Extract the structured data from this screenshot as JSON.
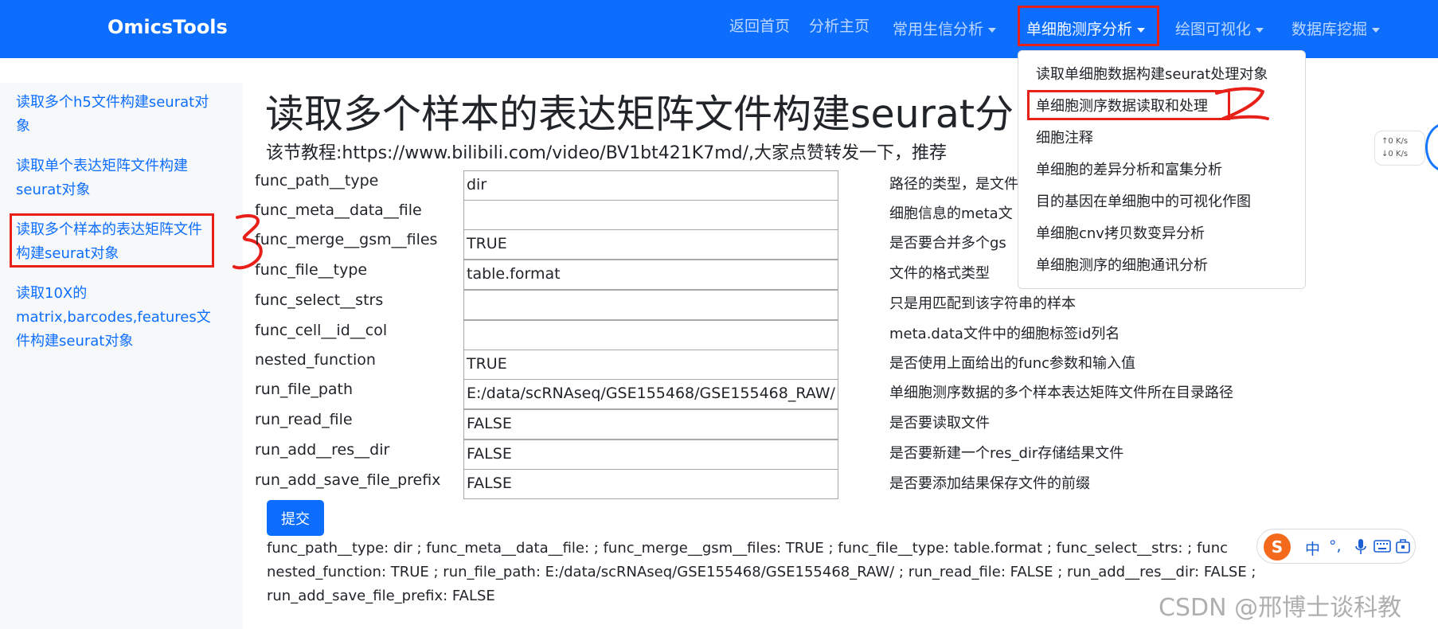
{
  "navbar": {
    "brand": "OmicsTools",
    "items": [
      {
        "label": "返回首页",
        "dropdown": false
      },
      {
        "label": "分析主页",
        "dropdown": false
      },
      {
        "label": "常用生信分析",
        "dropdown": true
      },
      {
        "label": "单细胞测序分析",
        "dropdown": true,
        "active": true
      },
      {
        "label": "绘图可视化",
        "dropdown": true
      },
      {
        "label": "数据库挖掘",
        "dropdown": true
      }
    ]
  },
  "dropdown": {
    "items": [
      "读取单细胞数据构建seurat处理对象",
      "单细胞测序数据读取和处理",
      "细胞注释",
      "单细胞的差异分析和富集分析",
      "目的基因在单细胞中的可视化作图",
      "单细胞cnv拷贝数变异分析",
      "单细胞测序的细胞通讯分析"
    ]
  },
  "sidebar": {
    "links": [
      "读取多个h5文件构建seurat对象",
      "读取单个表达矩阵文件构建seurat对象",
      "读取多个样本的表达矩阵文件构建seurat对象",
      "读取10X的matrix,barcodes,features文件构建seurat对象"
    ]
  },
  "main": {
    "title": "读取多个样本的表达矩阵文件构建seurat分",
    "subtitle": "该节教程:https://www.bilibili.com/video/BV1bt421K7md/,大家点赞转发一下，推荐",
    "params": [
      {
        "name": "func_path__type",
        "value": "dir",
        "desc": "路径的类型，是文件"
      },
      {
        "name": "func_meta__data__file",
        "value": "",
        "desc": "细胞信息的meta文"
      },
      {
        "name": "func_merge__gsm__files",
        "value": "TRUE",
        "desc": "是否要合并多个gs"
      },
      {
        "name": "func_file__type",
        "value": "table.format",
        "desc": "文件的格式类型"
      },
      {
        "name": "func_select__strs",
        "value": "",
        "desc": "只是用匹配到该字符串的样本"
      },
      {
        "name": "func_cell__id__col",
        "value": "",
        "desc": "meta.data文件中的细胞标签id列名"
      },
      {
        "name": "nested_function",
        "value": "TRUE",
        "desc": "是否使用上面给出的func参数和输入值"
      },
      {
        "name": "run_file_path",
        "value": "E:/data/scRNAseq/GSE155468/GSE155468_RAW/",
        "desc": "单细胞测序数据的多个样本表达矩阵文件所在目录路径"
      },
      {
        "name": "run_read_file",
        "value": "FALSE",
        "desc": "是否要读取文件"
      },
      {
        "name": "run_add__res__dir",
        "value": "FALSE",
        "desc": "是否要新建一个res_dir存储结果文件"
      },
      {
        "name": "run_add_save_file_prefix",
        "value": "FALSE",
        "desc": "是否要添加结果保存文件的前缀"
      }
    ],
    "submit_label": "提交",
    "result_lines": [
      "func_path__type: dir ; func_meta__data__file: ; func_merge__gsm__files: TRUE ; func_file__type: table.format ; func_select__strs: ; func",
      "nested_function: TRUE ; run_file_path: E:/data/scRNAseq/GSE155468/GSE155468_RAW/ ; run_read_file: FALSE ; run_add__res__dir: FALSE ;",
      "run_add_save_file_prefix: FALSE"
    ]
  },
  "speed_widget": {
    "up": "↑0 K/s",
    "down": "↓0 K/s"
  },
  "ime_bar": {
    "logo": "S",
    "items": [
      "中",
      "°,",
      "mic-icon",
      "keyboard-icon",
      "toolbox-icon"
    ]
  },
  "watermark": "CSDN @邢博士谈科教",
  "annotations": [
    "2",
    "3"
  ],
  "colors": {
    "navbar": "#0d6efd",
    "annotation": "#e8201a",
    "link": "#0d6efd"
  }
}
